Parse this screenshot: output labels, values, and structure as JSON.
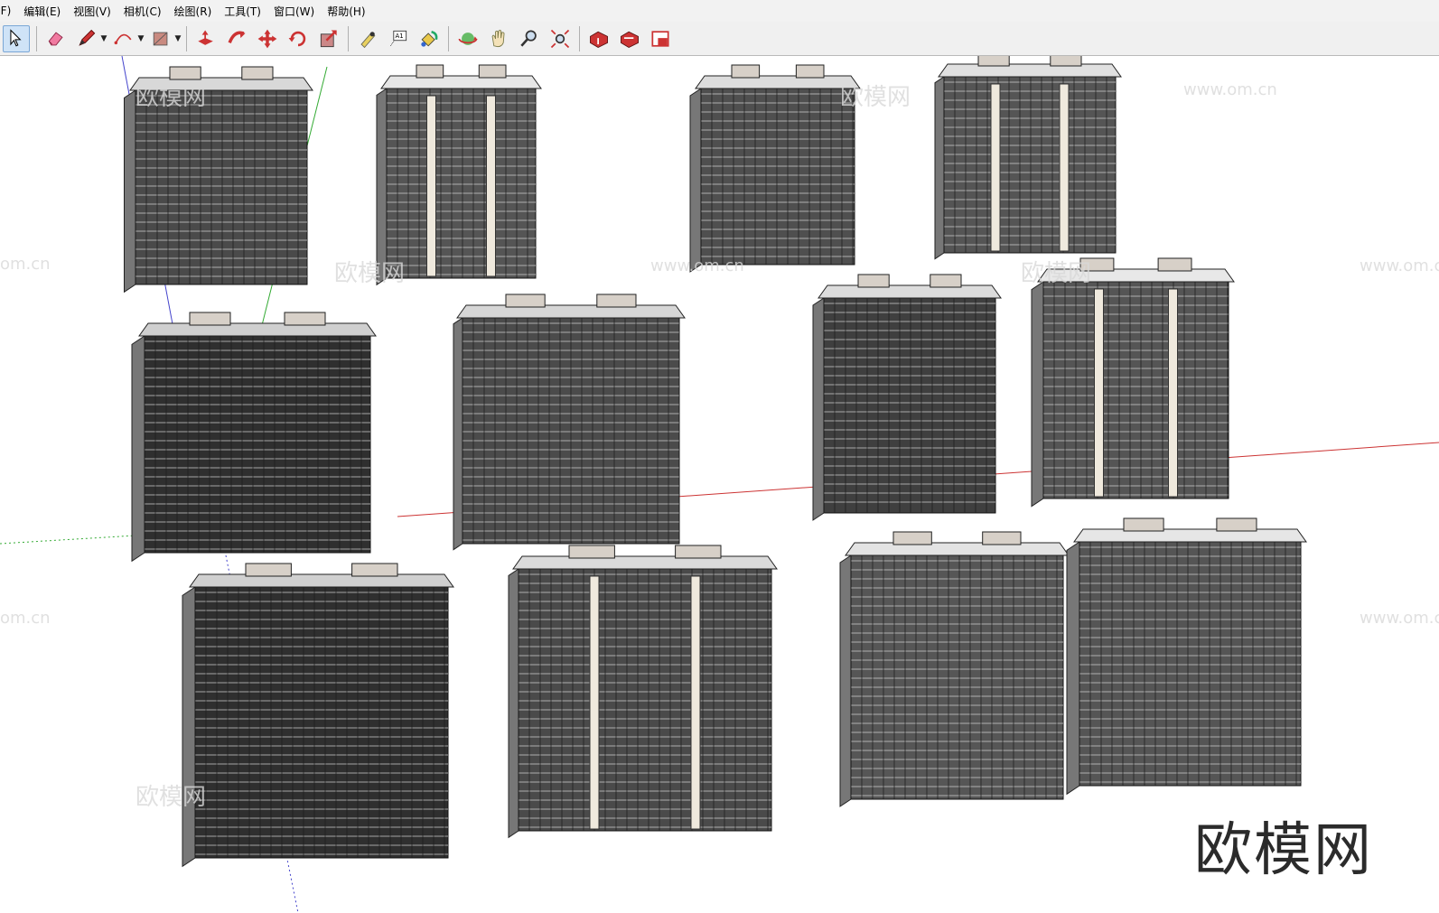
{
  "menu": [
    "(F)",
    "编辑(E)",
    "视图(V)",
    "相机(C)",
    "绘图(R)",
    "工具(T)",
    "窗口(W)",
    "帮助(H)"
  ],
  "toolbar": {
    "tools": [
      {
        "name": "select-icon",
        "active": true
      },
      {
        "name": "eraser-icon"
      },
      {
        "name": "pencil-icon",
        "dropdown": true
      },
      {
        "name": "arc-icon",
        "dropdown": true
      },
      {
        "name": "rectangle-icon",
        "dropdown": true
      },
      {
        "name": "push-pull-icon"
      },
      {
        "name": "follow-me-icon"
      },
      {
        "name": "move-icon"
      },
      {
        "name": "rotate-icon"
      },
      {
        "name": "scale-icon"
      },
      {
        "name": "tape-measure-icon"
      },
      {
        "name": "text-label-icon"
      },
      {
        "name": "paint-bucket-icon"
      },
      {
        "name": "orbit-icon"
      },
      {
        "name": "pan-icon"
      },
      {
        "name": "zoom-icon"
      },
      {
        "name": "zoom-extents-icon"
      },
      {
        "name": "warehouse-get-icon"
      },
      {
        "name": "warehouse-share-icon"
      },
      {
        "name": "extension-warehouse-icon"
      }
    ],
    "text_tool_label": "A1"
  },
  "viewport": {
    "brand_text": "欧模网",
    "watermark_text": "欧模网",
    "watermark_url": "www.om.cn",
    "axis_colors": {
      "red": "#c33",
      "green": "#3a3",
      "blue": "#44c"
    },
    "buildings_count": 12
  }
}
